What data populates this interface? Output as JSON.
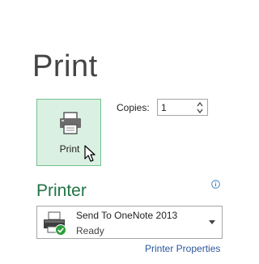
{
  "header": {
    "title": "Print"
  },
  "print_button": {
    "label": "Print",
    "icon": "printer-icon"
  },
  "copies": {
    "label": "Copies:",
    "value": "1"
  },
  "printer_section": {
    "title": "Printer",
    "info_icon": "info-icon",
    "selected_printer": {
      "name": "Send To OneNote 2013",
      "status": "Ready",
      "icon": "printer-device-icon",
      "status_icon": "check-icon"
    },
    "properties_link": "Printer Properties"
  },
  "colors": {
    "accent": "#217346",
    "button_fill": "#daf0e2",
    "button_border": "#74c08f",
    "link": "#2b579a"
  }
}
